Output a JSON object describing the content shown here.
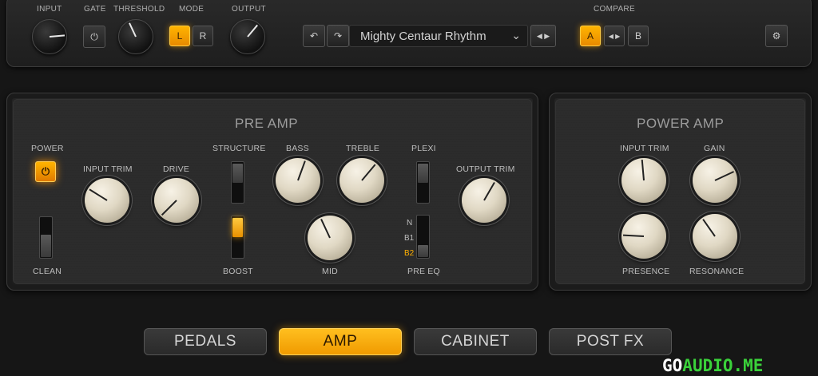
{
  "header": {
    "input_label": "INPUT",
    "gate_label": "GATE",
    "threshold_label": "THRESHOLD",
    "mode_label": "MODE",
    "mode_left": "L",
    "mode_right": "R",
    "output_label": "OUTPUT",
    "preset_name": "Mighty Centaur Rhythm",
    "compare_label": "COMPARE",
    "compare_a": "A",
    "compare_b": "B",
    "mode_selected": "L",
    "compare_selected": "A"
  },
  "pre_amp": {
    "title": "PRE AMP",
    "power_label": "POWER",
    "power_on": true,
    "clean_label": "CLEAN",
    "input_trim_label": "INPUT TRIM",
    "drive_label": "DRIVE",
    "structure_label": "STRUCTURE",
    "boost_label": "BOOST",
    "boost_on": true,
    "bass_label": "BASS",
    "treble_label": "TREBLE",
    "mid_label": "MID",
    "plexi_label": "PLEXI",
    "pre_eq_label": "PRE EQ",
    "pre_eq_options": [
      "N",
      "B1",
      "B2"
    ],
    "pre_eq_selected": "B2",
    "output_trim_label": "OUTPUT TRIM"
  },
  "power_amp": {
    "title": "POWER AMP",
    "input_trim_label": "INPUT TRIM",
    "gain_label": "GAIN",
    "presence_label": "PRESENCE",
    "resonance_label": "RESONANCE"
  },
  "tabs": [
    {
      "label": "PEDALS"
    },
    {
      "label": "AMP"
    },
    {
      "label": "CABINET"
    },
    {
      "label": "POST FX"
    }
  ],
  "active_tab": "AMP",
  "watermark": {
    "part1": "GO",
    "part2": "AUDIO.ME"
  },
  "colors": {
    "accent": "#ffb000",
    "background": "#161616",
    "knob_cream": "#e0d8c4"
  }
}
